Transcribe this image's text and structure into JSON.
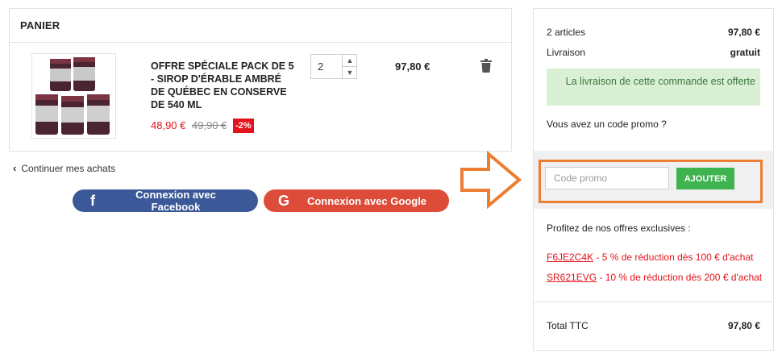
{
  "cart": {
    "title": "PANIER",
    "item": {
      "name": "OFFRE SPÉCIALE PACK DE 5 - SIROP D'ÉRABLE AMBRÉ DE QUÉBEC EN CONSERVE DE 540 ML",
      "price": "48,90 €",
      "old_price": "49,90 €",
      "discount": "-2%",
      "quantity": "2",
      "line_total": "97,80 €"
    }
  },
  "continue_label": "Continuer mes achats",
  "social": {
    "facebook_label": "Connexion avec Facebook",
    "google_label": "Connexion avec Google"
  },
  "summary": {
    "articles_label": "2 articles",
    "articles_value": "97,80 €",
    "shipping_label": "Livraison",
    "shipping_value": "gratuit",
    "shipping_notice": "La livraison de cette commande est offerte",
    "promo_question": "Vous avez un code promo ?",
    "promo_placeholder": "Code promo",
    "promo_button": "AJOUTER",
    "offers_title": "Profitez de nos offres exclusives :",
    "offers": [
      {
        "code": "F6JE2C4K",
        "text": " - 5 % de réduction dès 100 € d'achat"
      },
      {
        "code": "SR621EVG",
        "text": " - 10 % de réduction dès 200 € d'achat"
      }
    ],
    "total_label": "Total TTC",
    "total_value": "97,80 €"
  },
  "colors": {
    "facebook": "#3b5998",
    "google": "#dd4b39",
    "price_red": "#e3131b",
    "add_button": "#3fb34f",
    "highlight_orange": "#ed7d31",
    "notice_bg": "#d9f0d5"
  }
}
